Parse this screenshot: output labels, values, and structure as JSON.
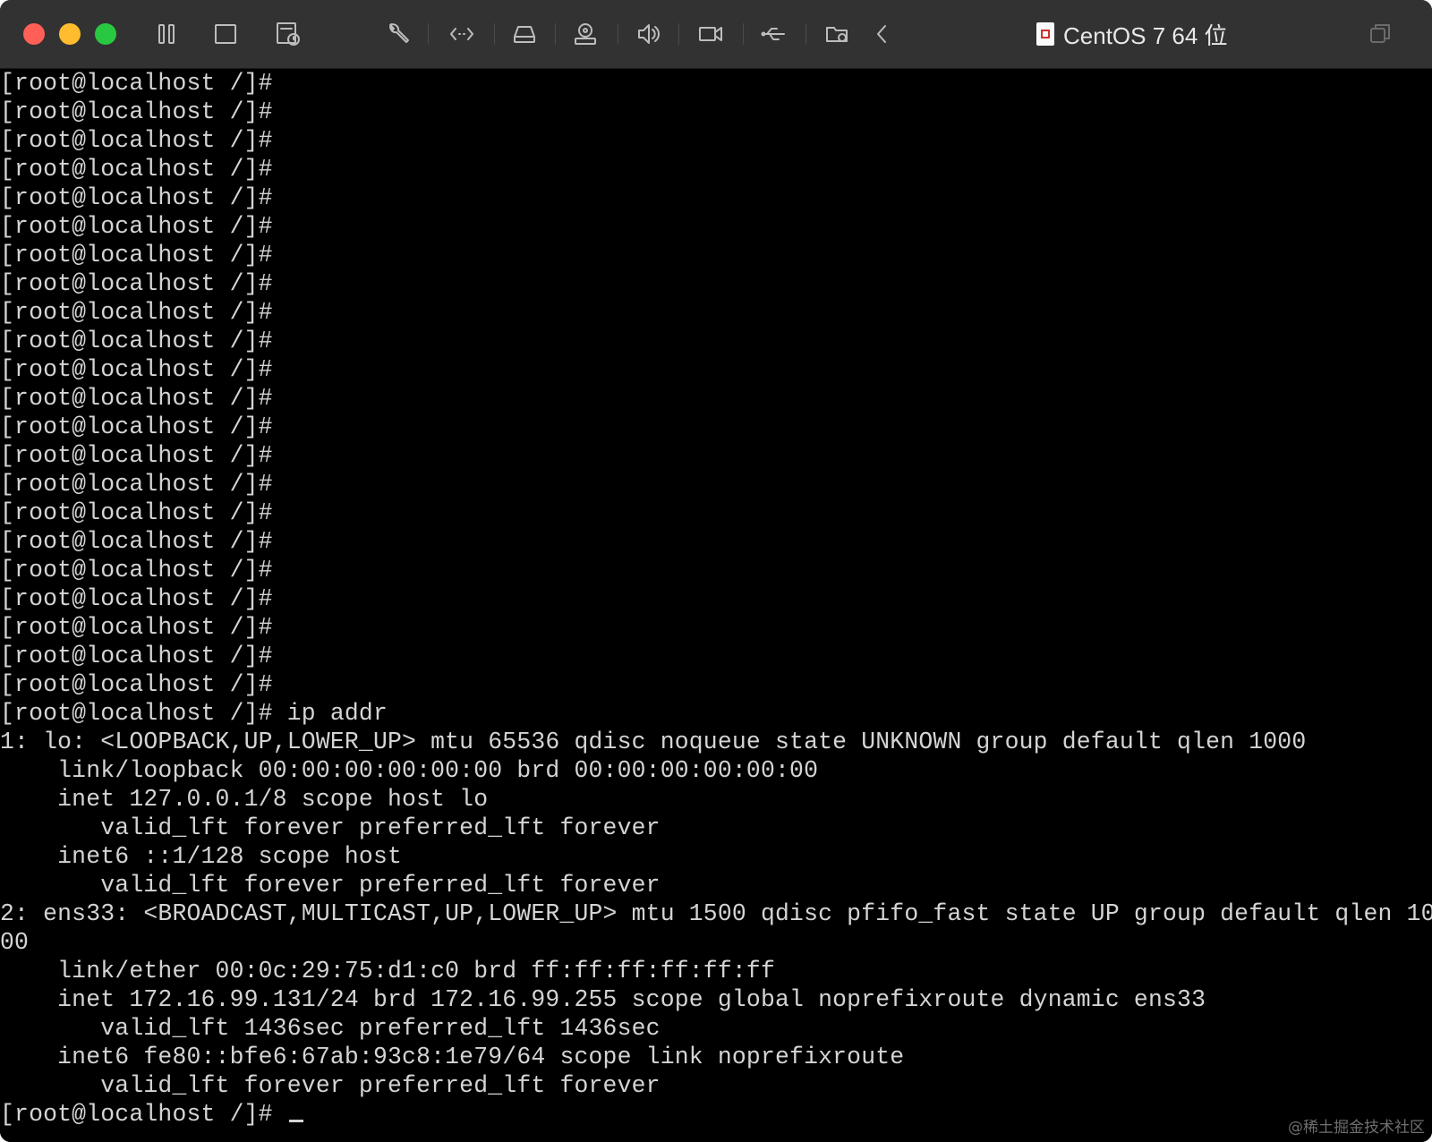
{
  "window": {
    "title": "CentOS 7 64 位"
  },
  "toolbar": {
    "icons": [
      "pause-icon",
      "window-icon",
      "snapshot-icon",
      "settings-wrench-icon",
      "code-icon",
      "drive-icon",
      "camera-icon",
      "volume-icon",
      "video-icon",
      "usb-icon",
      "shared-folder-icon",
      "back-icon",
      "copy-window-icon"
    ]
  },
  "terminal": {
    "lines": [
      "[root@localhost /]#",
      "[root@localhost /]#",
      "[root@localhost /]#",
      "[root@localhost /]#",
      "[root@localhost /]#",
      "[root@localhost /]#",
      "[root@localhost /]#",
      "[root@localhost /]#",
      "[root@localhost /]#",
      "[root@localhost /]#",
      "[root@localhost /]#",
      "[root@localhost /]#",
      "[root@localhost /]#",
      "[root@localhost /]#",
      "[root@localhost /]#",
      "[root@localhost /]#",
      "[root@localhost /]#",
      "[root@localhost /]#",
      "[root@localhost /]#",
      "[root@localhost /]#",
      "[root@localhost /]#",
      "[root@localhost /]#",
      "[root@localhost /]# ip addr",
      "1: lo: <LOOPBACK,UP,LOWER_UP> mtu 65536 qdisc noqueue state UNKNOWN group default qlen 1000",
      "    link/loopback 00:00:00:00:00:00 brd 00:00:00:00:00:00",
      "    inet 127.0.0.1/8 scope host lo",
      "       valid_lft forever preferred_lft forever",
      "    inet6 ::1/128 scope host",
      "       valid_lft forever preferred_lft forever",
      "2: ens33: <BROADCAST,MULTICAST,UP,LOWER_UP> mtu 1500 qdisc pfifo_fast state UP group default qlen 10",
      "00",
      "    link/ether 00:0c:29:75:d1:c0 brd ff:ff:ff:ff:ff:ff",
      "    inet 172.16.99.131/24 brd 172.16.99.255 scope global noprefixroute dynamic ens33",
      "       valid_lft 1436sec preferred_lft 1436sec",
      "    inet6 fe80::bfe6:67ab:93c8:1e79/64 scope link noprefixroute",
      "       valid_lft forever preferred_lft forever"
    ],
    "prompt_line": "[root@localhost /]# "
  },
  "watermark": "@稀土掘金技术社区"
}
